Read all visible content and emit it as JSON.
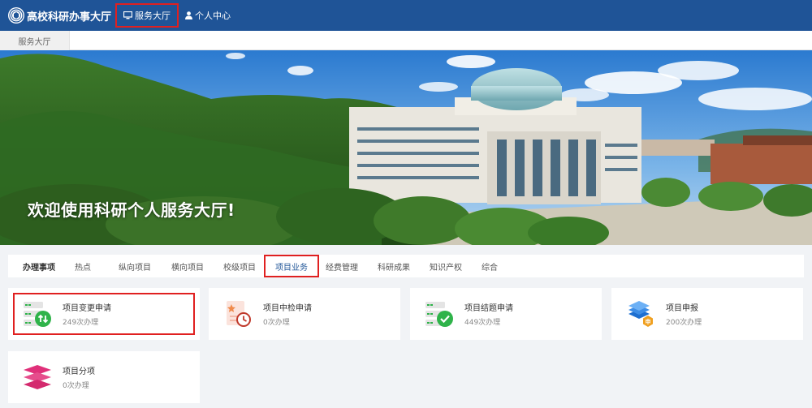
{
  "header": {
    "title": "高校科研办事大厅",
    "nav": [
      {
        "label": "服务大厅",
        "icon": "monitor-icon",
        "active": true
      },
      {
        "label": "个人中心",
        "icon": "user-icon",
        "active": false
      }
    ]
  },
  "breadcrumb": {
    "tab": "服务大厅"
  },
  "banner": {
    "headline": "欢迎使用科研个人服务大厅!"
  },
  "tabs": {
    "heading": "办理事项",
    "items": [
      "热点",
      "纵向项目",
      "横向项目",
      "校级项目",
      "项目业务",
      "经费管理",
      "科研成果",
      "知识产权",
      "综合"
    ],
    "active": "项目业务"
  },
  "services": [
    {
      "name": "项目变更申请",
      "count": "249次办理",
      "icon": "project-change-icon"
    },
    {
      "name": "项目中检申请",
      "count": "0次办理",
      "icon": "midterm-check-icon"
    },
    {
      "name": "项目结题申请",
      "count": "449次办理",
      "icon": "project-closing-icon"
    },
    {
      "name": "项目申报",
      "count": "200次办理",
      "icon": "project-apply-icon"
    },
    {
      "name": "项目分项",
      "count": "0次办理",
      "icon": "project-split-icon"
    }
  ],
  "colors": {
    "header_bg": "#1f5497",
    "highlight": "#e02020",
    "green": "#2fb34a",
    "orange": "#f0a020"
  }
}
